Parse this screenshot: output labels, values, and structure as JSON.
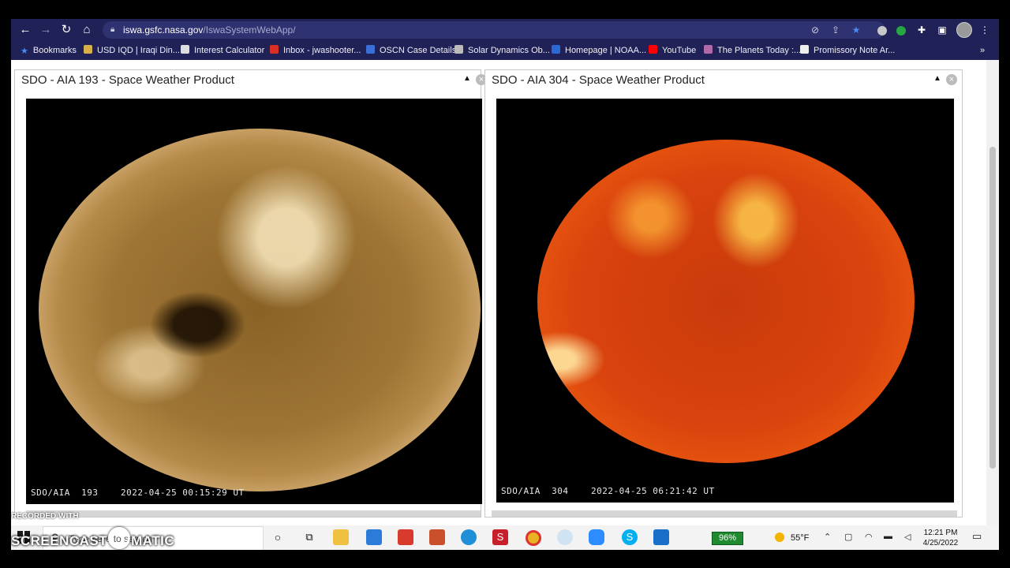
{
  "browser": {
    "url_host": "iswa.gsfc.nasa.gov",
    "url_path": "/IswaSystemWebApp/",
    "bookmarks": [
      {
        "label": "Bookmarks",
        "color": "#4a8af4"
      },
      {
        "label": "USD IQD | Iraqi Din...",
        "color": "#d8b04a"
      },
      {
        "label": "Interest Calculator",
        "color": "#dddddd"
      },
      {
        "label": "Inbox - jwashooter...",
        "color": "#d93025"
      },
      {
        "label": "OSCN Case Details",
        "color": "#3b6fd8"
      },
      {
        "label": "Solar Dynamics Ob...",
        "color": "#bbbbbb"
      },
      {
        "label": "Homepage | NOAA...",
        "color": "#2a6ad4"
      },
      {
        "label": "YouTube",
        "color": "#ff0000"
      },
      {
        "label": "The Planets Today :...",
        "color": "#b06aa8"
      },
      {
        "label": "Promissory Note Ar...",
        "color": "#eeeeee"
      }
    ],
    "more_bookmarks": "»"
  },
  "panels": [
    {
      "title": "SDO - AIA 193 - Space Weather Product",
      "caption": "SDO/AIA  193    2022-04-25 00:15:29 UT"
    },
    {
      "title": "SDO - AIA 304 - Space Weather Product",
      "caption": "SDO/AIA  304    2022-04-25 06:21:42 UT"
    }
  ],
  "taskbar": {
    "search_placeholder": "Type here to search",
    "battery": "96%",
    "temperature": "55°F",
    "time": "12:21 PM",
    "date": "4/25/2022"
  },
  "watermark": {
    "recorded_with": "RECORDED WITH",
    "brand_left": "SCREENCAST",
    "brand_right": "MATIC"
  }
}
